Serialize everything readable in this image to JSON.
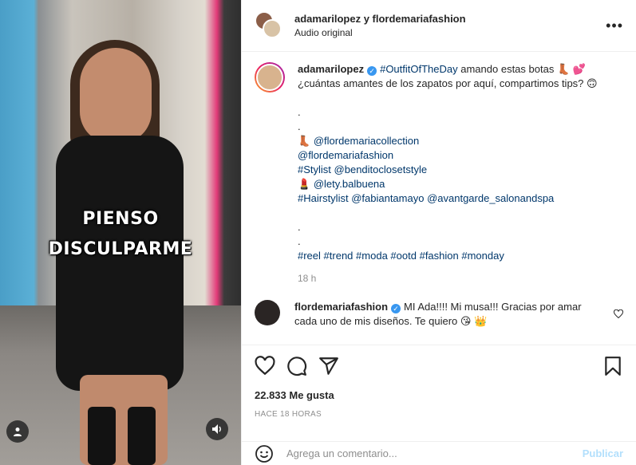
{
  "video": {
    "overlay_line1": "PIENSO",
    "overlay_line2": "DISCULPARME",
    "user_button_icon": "user-icon",
    "audio_button_icon": "speaker-icon"
  },
  "header": {
    "title": "adamarilopez y flordemariafashion",
    "subtitle": "Audio original",
    "more_icon": "more-options-icon",
    "more_label": "•••"
  },
  "caption": {
    "username": "adamarilopez",
    "hashtag_ootd": "#OutfitOfTheDay",
    "text_line1": " amando estas botas 👢 💕",
    "text_line2": "¿cuántas amantes de los zapatos por aquí, compartimos tips? 🙃",
    "dot1": ".",
    "dot2": ".",
    "boot_emoji": "👢",
    "mention_collection": "@flordemariacollection",
    "mention_fashion": "@flordemariafashion",
    "stylist_tag": "#Stylist",
    "stylist_mention": "@benditoclosetstyle",
    "lipstick_emoji": "💄",
    "mua_mention": "@lety.balbuena",
    "hairstylist_tag": "#Hairstylist",
    "hair_mention1": "@fabiantamayo",
    "hair_mention2": "@avantgarde_salonandspa",
    "dot3": ".",
    "dot4": ".",
    "tags": [
      "#reel",
      "#trend",
      "#moda",
      "#ootd",
      "#fashion",
      "#monday"
    ],
    "time": "18 h"
  },
  "comment": {
    "username": "flordemariafashion",
    "text": "MI Ada!!!! Mi musa!!! Gracias por amar cada uno de mis diseños. Te quiero 😘 👑"
  },
  "actions": {
    "like_icon": "heart-icon",
    "comment_icon": "comment-icon",
    "share_icon": "share-icon",
    "save_icon": "bookmark-icon"
  },
  "likes": "22.833 Me gusta",
  "ago": "HACE 18 HORAS",
  "comment_box": {
    "placeholder": "Agrega un comentario...",
    "publish": "Publicar",
    "emoji_icon": "emoji-icon"
  },
  "colors": {
    "link": "#00376b",
    "verified": "#3897f0",
    "publish_disabled": "#b2dffc",
    "muted": "#8e8e8e"
  }
}
